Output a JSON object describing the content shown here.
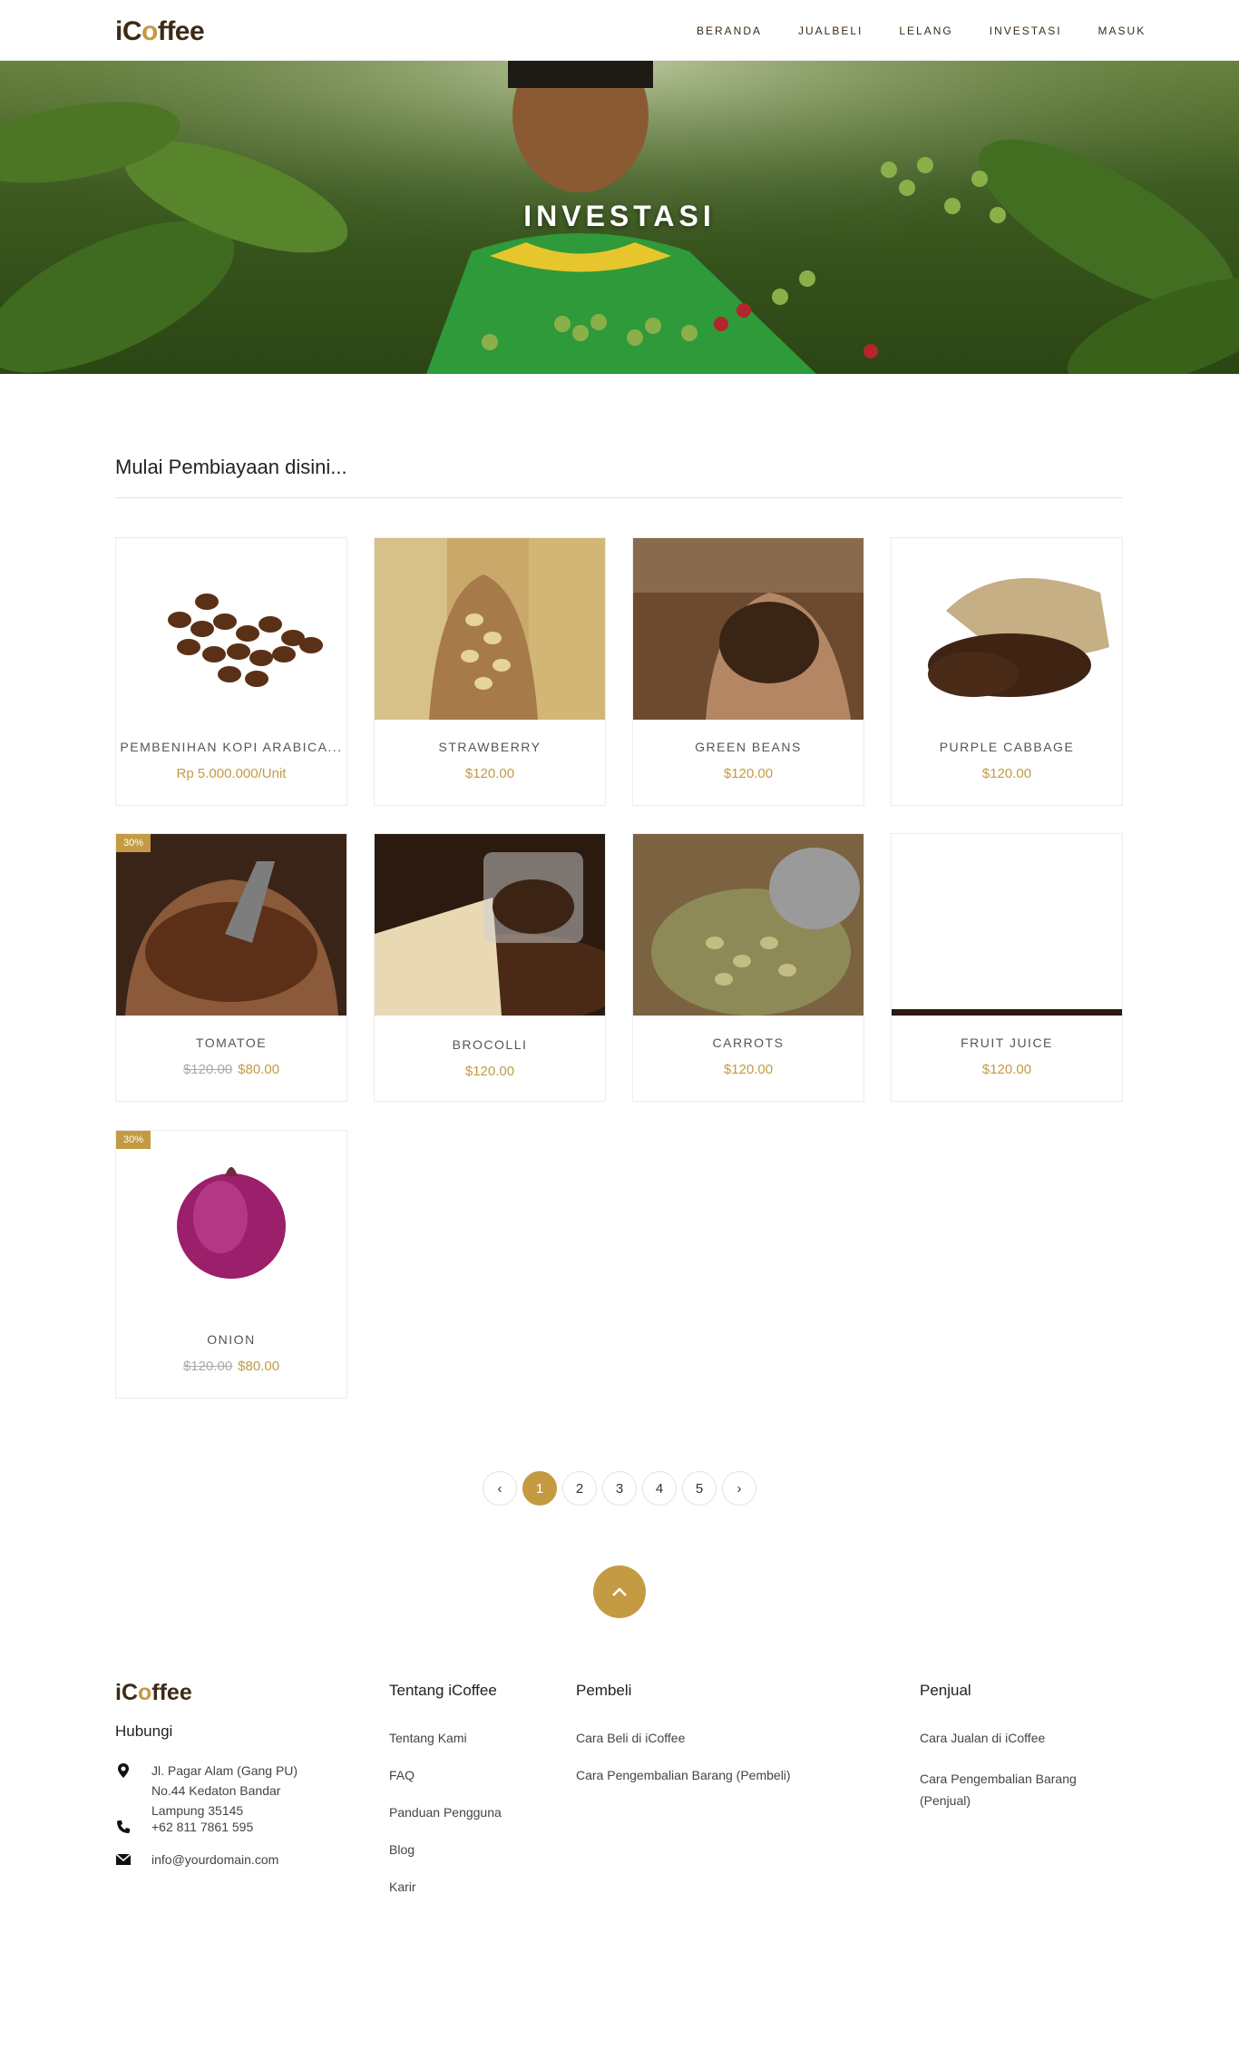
{
  "brand": {
    "logo_pre": "iC",
    "logo_cup": "o",
    "logo_post": "ffee"
  },
  "nav": {
    "items": [
      "BERANDA",
      "JUALBELI",
      "LELANG",
      "INVESTASI",
      "MASUK"
    ]
  },
  "hero": {
    "title": "INVESTASI"
  },
  "section": {
    "title": "Mulai Pembiayaan disini..."
  },
  "products": [
    {
      "name": "PEMBENIHAN KOPI ARABICA...",
      "price": "Rp 5.000.000/Unit",
      "old_price": "",
      "badge": ""
    },
    {
      "name": "STRAWBERRY",
      "price": "$120.00",
      "old_price": "",
      "badge": ""
    },
    {
      "name": "GREEN BEANS",
      "price": "$120.00",
      "old_price": "",
      "badge": ""
    },
    {
      "name": "PURPLE CABBAGE",
      "price": "$120.00",
      "old_price": "",
      "badge": ""
    },
    {
      "name": "TOMATOE",
      "price": "$80.00",
      "old_price": "$120.00",
      "badge": "30%"
    },
    {
      "name": "BROCOLLI",
      "price": "$120.00",
      "old_price": "",
      "badge": ""
    },
    {
      "name": "CARROTS",
      "price": "$120.00",
      "old_price": "",
      "badge": ""
    },
    {
      "name": "FRUIT JUICE",
      "price": "$120.00",
      "old_price": "",
      "badge": ""
    },
    {
      "name": "ONION",
      "price": "$80.00",
      "old_price": "$120.00",
      "badge": "30%"
    }
  ],
  "pagination": {
    "prev": "‹",
    "pages": [
      "1",
      "2",
      "3",
      "4",
      "5"
    ],
    "next": "›",
    "current": "1"
  },
  "footer": {
    "contact_heading": "Hubungi",
    "address": "Jl. Pagar Alam (Gang PU) No.44 Kedaton Bandar Lampung 35145",
    "phone": "+62 811 7861 595",
    "email": "info@yourdomain.com",
    "about": {
      "heading": "Tentang iCoffee",
      "links": [
        "Tentang Kami",
        "FAQ",
        "Panduan Pengguna",
        "Blog",
        "Karir"
      ]
    },
    "buyer": {
      "heading": "Pembeli",
      "links": [
        "Cara Beli di iCoffee",
        "Cara Pengembalian Barang (Pembeli)"
      ]
    },
    "seller": {
      "heading": "Penjual",
      "links": [
        "Cara Jualan di iCoffee",
        "Cara Pengembalian Barang (Penjual)"
      ]
    }
  },
  "colors": {
    "accent": "#c49a43",
    "brand_dark": "#3d2b16"
  }
}
